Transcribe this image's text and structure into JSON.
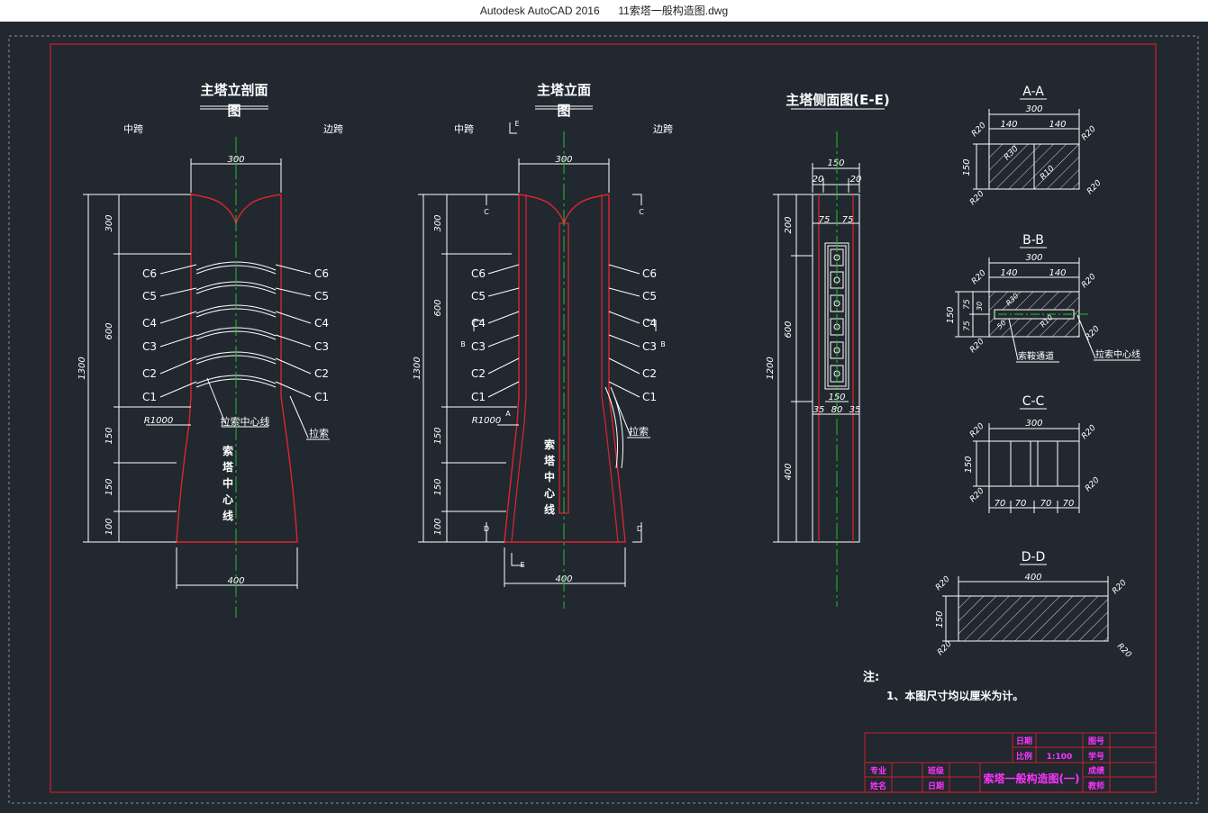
{
  "window": {
    "title_app": "Autodesk AutoCAD 2016",
    "title_file": "11索塔一般构造图.dwg"
  },
  "colors": {
    "background": "#212830",
    "frame": "#cc1f2a",
    "line": "#ffffff",
    "centerline": "#22c02a",
    "magenta": "#ff33ff",
    "tower": "#e0242e"
  },
  "views": {
    "section": {
      "title_a": "主塔立剖面",
      "title_b": "图",
      "left_label": "中跨",
      "right_label": "边跨",
      "cables": [
        "C6",
        "C5",
        "C4",
        "C3",
        "C2",
        "C1"
      ],
      "dim_top": "300",
      "dim_bottom": "400",
      "dims_left": [
        "300",
        "600",
        "150",
        "150",
        "100"
      ],
      "dim_total": "1300",
      "radius": "R1000",
      "note_center": "拉索中心线",
      "note_cable": "拉索",
      "tower_center": [
        "索",
        "塔",
        "中",
        "心",
        "线"
      ]
    },
    "elevation": {
      "title_a": "主塔立面",
      "title_b": "图",
      "left_label": "中跨",
      "right_label": "边跨",
      "cables": [
        "C6",
        "C5",
        "C4",
        "C3",
        "C2",
        "C1"
      ],
      "dim_top": "300",
      "dim_bottom": "400",
      "dims_left": [
        "300",
        "600",
        "150",
        "150",
        "100"
      ],
      "dim_total": "1300",
      "radius": "R1000",
      "note_cable": "拉索",
      "tower_center": [
        "索",
        "塔",
        "中",
        "心",
        "线"
      ],
      "section_marks": [
        "C",
        "C",
        "B",
        "B",
        "A",
        "D",
        "D",
        "E",
        "E"
      ]
    },
    "side": {
      "title": "主塔侧面图(E-E)",
      "dim_top": "150",
      "dims_top_small": [
        "20",
        "20"
      ],
      "dims_inner": [
        "75",
        "75"
      ],
      "dims_bottom": [
        "150",
        "35",
        "80",
        "35"
      ],
      "dims_left": [
        "200",
        "600",
        "400"
      ],
      "dim_total": "1200"
    },
    "aa": {
      "title": "A-A",
      "w": "300",
      "half": [
        "140",
        "140"
      ],
      "h": "150",
      "radii": [
        "R20",
        "R20",
        "R20",
        "R20",
        "R30",
        "R10"
      ]
    },
    "bb": {
      "title": "B-B",
      "w": "300",
      "half": [
        "140",
        "140"
      ],
      "h": "150",
      "small": [
        "75",
        "75",
        "30",
        "50"
      ],
      "radii": [
        "R20",
        "R20",
        "R20",
        "R20",
        "R30",
        "R10"
      ],
      "note_channel": "索鞍通道",
      "note_center": "拉索中心线"
    },
    "cc": {
      "title": "C-C",
      "w": "300",
      "h": "150",
      "parts": [
        "70",
        "70",
        "70",
        "70"
      ],
      "radii": [
        "R20",
        "R20",
        "R20",
        "R20"
      ]
    },
    "dd": {
      "title": "D-D",
      "w": "400",
      "h": "150",
      "radii": [
        "R20",
        "R20",
        "R20",
        "R20"
      ]
    }
  },
  "notes": {
    "heading": "注:",
    "line1": "1、本图尺寸均以厘米为计。"
  },
  "titleblock": {
    "date_label": "日期",
    "scale_label": "比例",
    "scale_value": "1:100",
    "figure_no_label": "图号",
    "student_no_label": "学号",
    "major_label": "专业",
    "class_label": "班级",
    "grade_label": "成绩",
    "name_label": "姓名",
    "date2_label": "日期",
    "teacher_label": "教师",
    "drawing_title": "索塔一般构造图(一)"
  }
}
